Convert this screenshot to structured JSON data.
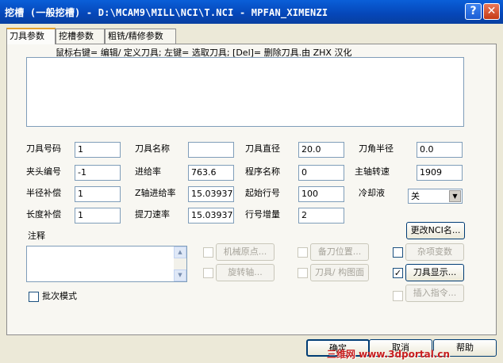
{
  "window": {
    "title": "挖槽 (一般挖槽) - D:\\MCAM9\\MILL\\NCI\\T.NCI - MPFAN_XIMENZI",
    "help_glyph": "?",
    "close_glyph": "✕"
  },
  "tabs": [
    {
      "label": "刀具参数"
    },
    {
      "label": "挖槽参数"
    },
    {
      "label": "粗铣/精修参数"
    }
  ],
  "hint": "鼠标右键= 编辑/ 定义刀具; 左键= 选取刀具; [Del]= 删除刀具.由 ZHX 汉化",
  "fields": {
    "tool_number": {
      "label": "刀具号码",
      "value": "1"
    },
    "tool_name": {
      "label": "刀具名称",
      "value": ""
    },
    "tool_diameter": {
      "label": "刀具直径",
      "value": "20.0"
    },
    "corner_radius": {
      "label": "刀角半径",
      "value": "0.0"
    },
    "holder_number": {
      "label": "夹头编号",
      "value": "-1"
    },
    "feed_rate": {
      "label": "进给率",
      "value": "763.6"
    },
    "program_name": {
      "label": "程序名称",
      "value": "0"
    },
    "spindle_speed": {
      "label": "主轴转速",
      "value": "1909"
    },
    "radius_comp": {
      "label": "半径补偿",
      "value": "1"
    },
    "plunge_rate": {
      "label": "Z轴进给率",
      "value": "15.03937"
    },
    "start_seq": {
      "label": "起始行号",
      "value": "100"
    },
    "coolant": {
      "label": "冷却液",
      "value": "关"
    },
    "length_comp": {
      "label": "长度补偿",
      "value": "1"
    },
    "retract_rate": {
      "label": "提刀速率",
      "value": "15.03937"
    },
    "seq_increment": {
      "label": "行号增量",
      "value": "2"
    }
  },
  "notes_label": "注释",
  "buttons": {
    "change_nci": "更改NCI名...",
    "machine_origin": "机械原点...",
    "rotary_axis": "旋转轴...",
    "tool_change_pos": "备刀位置...",
    "tool_plane": "刀具/ 构图面",
    "misc_values": "杂项变数",
    "tool_display": "刀具显示...",
    "insert_command": "插入指令...",
    "ok": "确定",
    "cancel": "取消",
    "help": "帮助"
  },
  "checks": {
    "machine_origin": false,
    "rotary_axis": false,
    "tool_change_pos": false,
    "tool_plane": false,
    "misc_values": false,
    "tool_display": true,
    "insert_command": false,
    "batch_mode": false
  },
  "batch_mode_label": "批次模式",
  "watermark": "三维网 www.3dportal.cn"
}
